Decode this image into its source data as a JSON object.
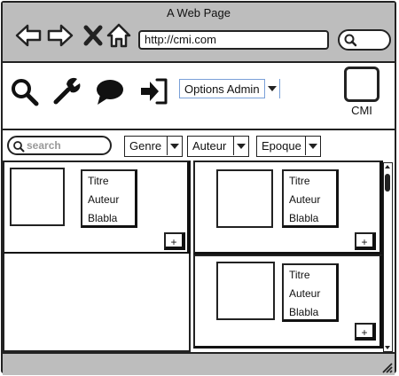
{
  "window": {
    "title": "A Web Page"
  },
  "browser": {
    "url": "http://cmi.com",
    "nav_icons": [
      "back-icon",
      "forward-icon",
      "close-icon",
      "home-icon"
    ]
  },
  "toolbar": {
    "icons": [
      "search-icon",
      "wrench-icon",
      "chat-icon",
      "sign-in-icon"
    ],
    "options_select": "Options Admin",
    "brand_label": "CMI"
  },
  "filters": {
    "search_placeholder": "search",
    "genre": "Genre",
    "auteur": "Auteur",
    "epoque": "Epoque"
  },
  "cards": [
    {
      "title": "Titre",
      "author": "Auteur",
      "text": "Blabla",
      "add": "+"
    },
    {
      "title": "Titre",
      "author": "Auteur",
      "text": "Blabla",
      "add": "+"
    },
    {
      "title": "Titre",
      "author": "Auteur",
      "text": "Blabla",
      "add": "+"
    }
  ]
}
